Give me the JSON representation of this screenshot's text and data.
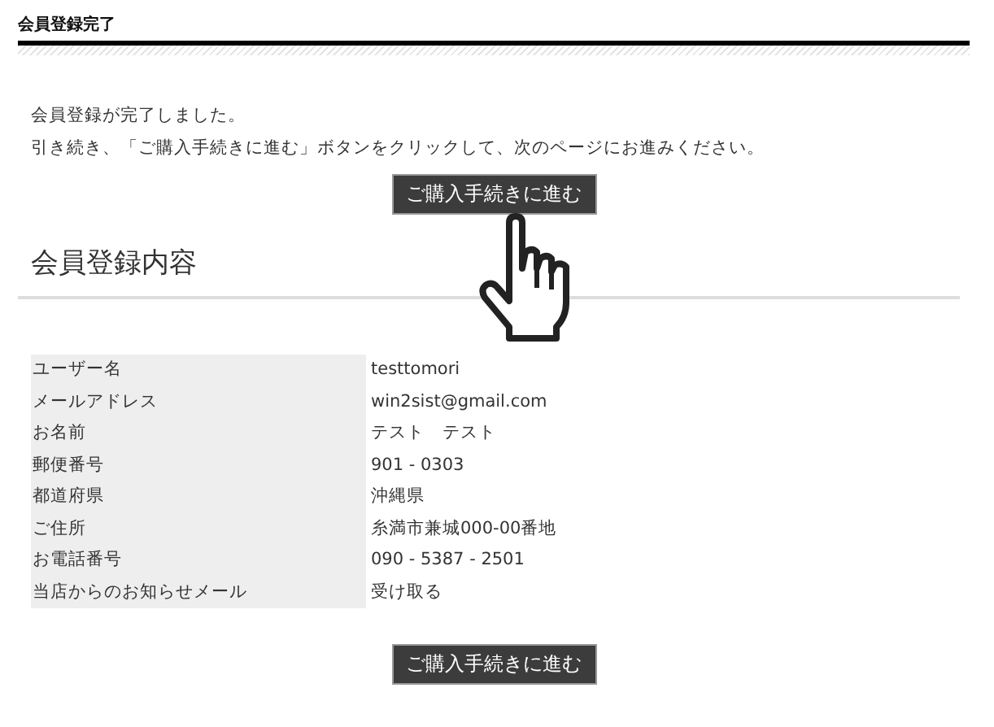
{
  "page_title": "会員登録完了",
  "messages": [
    "会員登録が完了しました。",
    "引き続き、「ご購入手続きに進む」ボタンをクリックして、次のページにお進みください。"
  ],
  "top_button": "ご購入手続きに進む",
  "section_heading": "会員登録内容",
  "rows": [
    {
      "label": "ユーザー名",
      "value": "testtomori"
    },
    {
      "label": "メールアドレス",
      "value": "win2sist@gmail.com"
    },
    {
      "label": "お名前",
      "value": "テスト　テスト"
    },
    {
      "label": "郵便番号",
      "value": "901 - 0303"
    },
    {
      "label": "都道府県",
      "value": "沖縄県"
    },
    {
      "label": "ご住所",
      "value": "糸満市兼城000-00番地"
    },
    {
      "label": "お電話番号",
      "value": "090 - 5387 - 2501"
    },
    {
      "label": "当店からのお知らせメール",
      "value": "受け取る"
    }
  ],
  "bottom_button": "ご購入手続きに進む"
}
